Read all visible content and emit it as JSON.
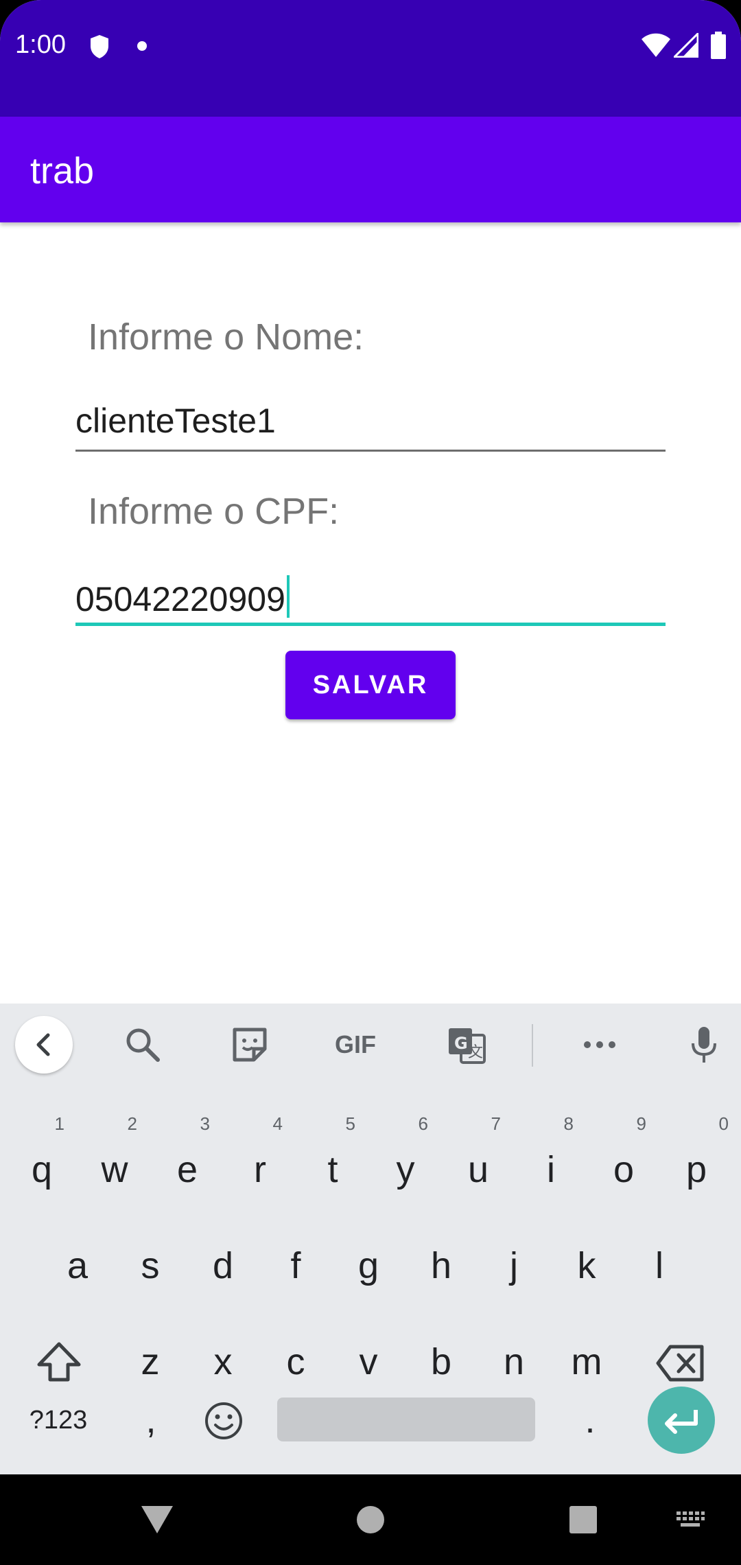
{
  "status_bar": {
    "time": "1:00"
  },
  "app_bar": {
    "title": "trab"
  },
  "form": {
    "name_label": "Informe o Nome:",
    "name_value": "clienteTeste1",
    "cpf_label": "Informe o CPF:",
    "cpf_value": "05042220909",
    "save_label": "SALVAR"
  },
  "keyboard": {
    "row1": [
      {
        "key": "q",
        "hint": "1"
      },
      {
        "key": "w",
        "hint": "2"
      },
      {
        "key": "e",
        "hint": "3"
      },
      {
        "key": "r",
        "hint": "4"
      },
      {
        "key": "t",
        "hint": "5"
      },
      {
        "key": "y",
        "hint": "6"
      },
      {
        "key": "u",
        "hint": "7"
      },
      {
        "key": "i",
        "hint": "8"
      },
      {
        "key": "o",
        "hint": "9"
      },
      {
        "key": "p",
        "hint": "0"
      }
    ],
    "row2": [
      "a",
      "s",
      "d",
      "f",
      "g",
      "h",
      "j",
      "k",
      "l"
    ],
    "row3": [
      "z",
      "x",
      "c",
      "v",
      "b",
      "n",
      "m"
    ],
    "symbols_label": "?123",
    "comma": ",",
    "period": ".",
    "toolbar_icons": [
      "back-chevron-icon",
      "search-icon",
      "sticker-icon",
      "gif-icon",
      "translate-icon",
      "more-icon",
      "mic-icon"
    ],
    "gif_label": "GIF"
  },
  "colors": {
    "status_bar": "#3700b3",
    "app_bar": "#6200ee",
    "accent": "#1ec8b8",
    "enter_key": "#4db6ac"
  }
}
